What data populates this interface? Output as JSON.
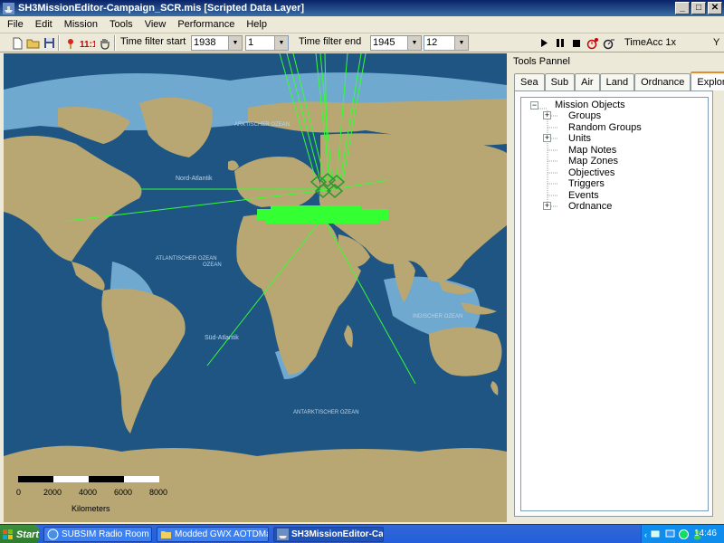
{
  "window": {
    "title": "SH3MissionEditor-Campaign_SCR.mis [Scripted Data Layer]",
    "app_icon": "ship-icon"
  },
  "menu": [
    "File",
    "Edit",
    "Mission",
    "Tools",
    "View",
    "Performance",
    "Help"
  ],
  "toolbar": {
    "time_filter_start_label": "Time filter start",
    "start_year": "1938",
    "start_month": "1",
    "time_filter_end_label": "Time filter end",
    "end_year": "1945",
    "end_month": "12",
    "timeacc_label": "TimeAcc 1x",
    "y_label": "Y",
    "icons": [
      "new-file-icon",
      "open-folder-icon",
      "save-icon",
      "pin-icon",
      "red-units-icon",
      "hand-pan-icon",
      "play-icon",
      "pause-icon",
      "stop-icon",
      "record-icon",
      "settings-icon"
    ]
  },
  "map": {
    "labels": {
      "arctic": "ARKTISCHER OZEAN",
      "north_atlantic": "Nord-Atlantik",
      "atlantic": "ATLANTISCHER OZEAN",
      "south_atlantic": "Süd-Atlantik",
      "indian": "INDISCHER OZEAN",
      "antarctic": "ANTARKTISCHER OZEAN"
    },
    "scale": {
      "ticks": [
        "0",
        "2000",
        "4000",
        "6000",
        "8000"
      ],
      "unit": "Kilometers"
    },
    "colors": {
      "ocean": "#1f5583",
      "shelf": "#6fa9cf",
      "land": "#b8a772",
      "route": "#33ff33"
    }
  },
  "tools_panel": {
    "title": "Tools Pannel",
    "tabs": [
      "Sea",
      "Sub",
      "Air",
      "Land",
      "Ordnance",
      "Explorer"
    ],
    "active_tab": "Explorer",
    "tree": {
      "root": "Mission Objects",
      "children": [
        {
          "label": "Groups",
          "expandable": true
        },
        {
          "label": "Random Groups",
          "expandable": false
        },
        {
          "label": "Units",
          "expandable": true
        },
        {
          "label": "Map Notes",
          "expandable": false
        },
        {
          "label": "Map Zones",
          "expandable": false
        },
        {
          "label": "Objectives",
          "expandable": false
        },
        {
          "label": "Triggers",
          "expandable": false
        },
        {
          "label": "Events",
          "expandable": false
        },
        {
          "label": "Ordnance",
          "expandable": true
        }
      ]
    }
  },
  "taskbar": {
    "start_label": "Start",
    "tasks": [
      {
        "label": "SUBSIM Radio Room For...",
        "icon": "browser-icon",
        "active": false
      },
      {
        "label": "Modded GWX AOTDMax",
        "icon": "folder-icon",
        "active": false
      },
      {
        "label": "SH3MissionEditor-Ca...",
        "icon": "ship-icon",
        "active": true
      }
    ],
    "clock": "14:46",
    "tray_icons": [
      "arrow-left-icon",
      "network-icon",
      "monitor-icon",
      "globe-icon",
      "messenger-icon"
    ]
  }
}
